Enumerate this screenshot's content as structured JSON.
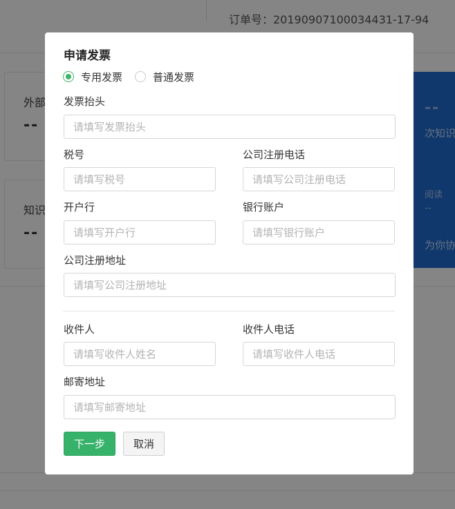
{
  "background": {
    "order_number": "订单号：20190907100034431-17-94",
    "cards": [
      {
        "label": "外部",
        "value": "--"
      },
      {
        "label": "知识",
        "value": "--"
      }
    ],
    "blue_panel": {
      "value": "--",
      "text1": "次知识",
      "text2": "阅读",
      "text3": "--",
      "text4": "为你协"
    }
  },
  "modal": {
    "title": "申请发票",
    "invoice_types": [
      {
        "label": "专用发票",
        "selected": true
      },
      {
        "label": "普通发票",
        "selected": false
      }
    ],
    "fields": {
      "invoice_title": {
        "label": "发票抬头",
        "placeholder": "请填写发票抬头",
        "value": ""
      },
      "tax_number": {
        "label": "税号",
        "placeholder": "请填写税号",
        "value": ""
      },
      "company_phone": {
        "label": "公司注册电话",
        "placeholder": "请填写公司注册电话",
        "value": ""
      },
      "bank": {
        "label": "开户行",
        "placeholder": "请填写开户行",
        "value": ""
      },
      "bank_account": {
        "label": "银行账户",
        "placeholder": "请填写银行账户",
        "value": ""
      },
      "company_address": {
        "label": "公司注册地址",
        "placeholder": "请填写公司注册地址",
        "value": ""
      },
      "recipient": {
        "label": "收件人",
        "placeholder": "请填写收件人姓名",
        "value": ""
      },
      "recipient_phone": {
        "label": "收件人电话",
        "placeholder": "请填写收件人电话",
        "value": ""
      },
      "mail_address": {
        "label": "邮寄地址",
        "placeholder": "请填写邮寄地址",
        "value": ""
      }
    },
    "buttons": {
      "next": "下一步",
      "cancel": "取消"
    },
    "colors": {
      "accent": "#36b26a",
      "overlay": "rgba(0,0,0,0.48)",
      "blue_panel": "#1f6bd0"
    }
  }
}
